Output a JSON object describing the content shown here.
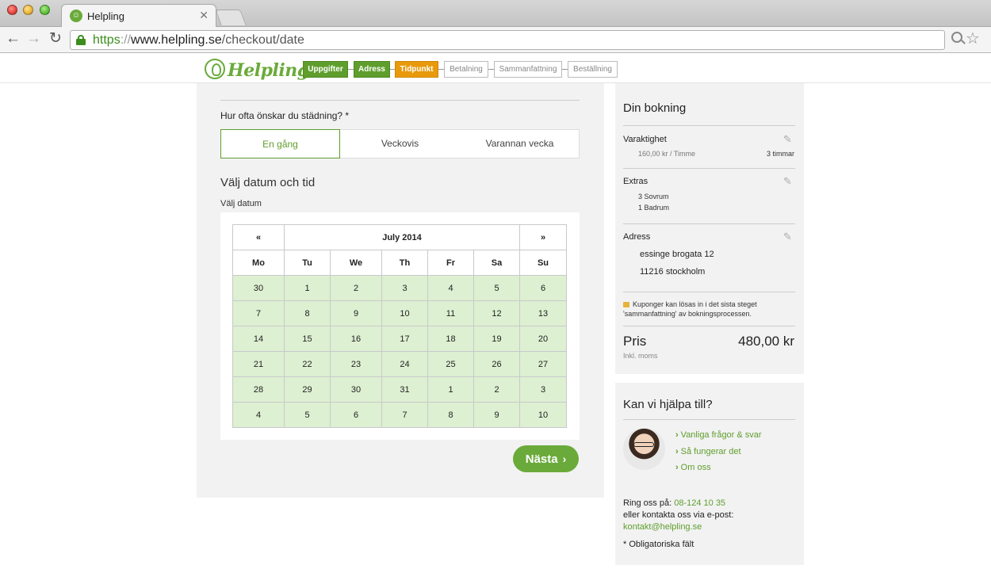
{
  "browser": {
    "tab_title": "Helpling",
    "url_scheme": "https",
    "url_sep": "://",
    "url_host": "www.helpling.se",
    "url_path": "/checkout/date"
  },
  "header": {
    "logo_text": "Helpling",
    "steps": [
      {
        "label": "Uppgifter",
        "state": "done"
      },
      {
        "label": "Adress",
        "state": "done"
      },
      {
        "label": "Tidpunkt",
        "state": "active"
      },
      {
        "label": "Betalning",
        "state": "todo"
      },
      {
        "label": "Sammanfattning",
        "state": "todo"
      },
      {
        "label": "Beställning",
        "state": "todo"
      }
    ]
  },
  "main": {
    "frequency_question": "Hur ofta önskar du städning? *",
    "frequency_options": [
      "En gång",
      "Veckovis",
      "Varannan vecka"
    ],
    "selected_frequency": "En gång",
    "section_title": "Välj datum och tid",
    "date_label": "Välj datum",
    "calendar": {
      "prev": "«",
      "next": "»",
      "month": "July 2014",
      "weekdays": [
        "Mo",
        "Tu",
        "We",
        "Th",
        "Fr",
        "Sa",
        "Su"
      ],
      "weeks": [
        [
          "30",
          "1",
          "2",
          "3",
          "4",
          "5",
          "6"
        ],
        [
          "7",
          "8",
          "9",
          "10",
          "11",
          "12",
          "13"
        ],
        [
          "14",
          "15",
          "16",
          "17",
          "18",
          "19",
          "20"
        ],
        [
          "21",
          "22",
          "23",
          "24",
          "25",
          "26",
          "27"
        ],
        [
          "28",
          "29",
          "30",
          "31",
          "1",
          "2",
          "3"
        ],
        [
          "4",
          "5",
          "6",
          "7",
          "8",
          "9",
          "10"
        ]
      ]
    },
    "next_button": "Nästa",
    "next_chevron": "›"
  },
  "booking": {
    "title": "Din bokning",
    "duration_label": "Varaktighet",
    "rate": "160,00 kr / Timme",
    "hours": "3 timmar",
    "extras_label": "Extras",
    "extras": [
      "3 Sovrum",
      "1 Badrum"
    ],
    "address_label": "Adress",
    "address_street": "essinge brogata 12",
    "address_city": "11216 stockholm",
    "coupon_note": "Kuponger kan lösas in i det sista steget 'sammanfattning' av bokningsprocessen.",
    "price_label": "Pris",
    "price_value": "480,00 kr",
    "price_note": "Inkl. moms"
  },
  "help": {
    "title": "Kan vi hjälpa till?",
    "links": [
      "Vanliga frågor & svar",
      "Så fungerar det",
      "Om oss"
    ],
    "call_label": "Ring oss på:",
    "phone": "08-124 10 35",
    "email_label": "eller kontakta oss via e-post:",
    "email": "kontakt@helpling.se",
    "required_note": "* Obligatoriska fält"
  }
}
